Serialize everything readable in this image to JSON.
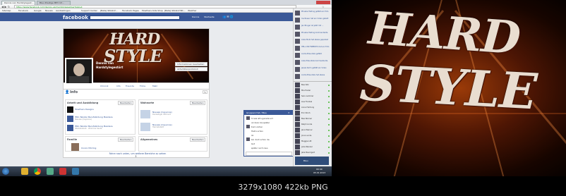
{
  "browser": {
    "active_tab": "Dennis van Hardstylegest…",
    "second_tab": "Bleu Prestige MP3 Inf…",
    "address": "https://www.facebook.com/dennis.vanhardstylegestoert/about",
    "bookmarks": [
      "Sitemap",
      "Facebook",
      "Google",
      "Nieuws",
      "Aanbiedingen",
      "Support Center",
      "[Beta] Stikstof…",
      "Facebook Pages",
      "Moethers Kids Shop",
      "[Beta] Stikstof Bit…",
      "Weather"
    ]
  },
  "facebook": {
    "logo": "facebook",
    "nav_links": [
      "Dennis",
      "Startseite"
    ],
    "profile_name_line1": "Dennis van",
    "profile_name_line2": "Hardstylegestört",
    "cover_buttons": [
      "Informationen bearbeiten",
      "Aktivitätenprotokoll"
    ],
    "profile_tabs": [
      "Chronik",
      "Info",
      "Freunde",
      "Fotos",
      "Mehr"
    ],
    "info_heading": "Info",
    "work_heading": "Arbeit und Ausbildung",
    "residence_heading": "Wohnorte",
    "family_heading": "Familie",
    "edit_label": "Bearbeiten",
    "work_items": [
      {
        "title": "Moethers Designs",
        "sub": ""
      },
      {
        "title": "HBA Tekstar Berufsbildung Meistere",
        "sub": "Nieuwe (Cayenne)"
      },
      {
        "title": "HBA Tekstar Berufsbildung Meistere",
        "sub": "Werkstudent · 2012 bis heute"
      }
    ],
    "residence_items": [
      {
        "title": "Nieuwe (Cayenne)",
        "sub": "Derzeitiger Wohnort"
      },
      {
        "title": "Nieuwe (Cayenne)",
        "sub": "Heimatstadt"
      }
    ],
    "family_items": [
      "Uxxxx Mörling"
    ],
    "details_heading": "Allgemeines",
    "scroll_hint": "Fahre nach unten, um weitere Bereiche zu sehen"
  },
  "chat": {
    "title": "Gruppenchat / Bleu",
    "messages": [
      "hi wie ist's gerade so?",
      "ok dann bis später",
      "Kurz vorbei",
      "Hab's schon",
      "lol",
      "bin doch schon da",
      "Gut",
      "später noch raus"
    ]
  },
  "sidebar": {
    "ticker": [
      "Phoebe Halting gefällt ein Foto",
      "Ina Rosen hat ein Video geteilt",
      "Jan Bruger ist jetzt mit …",
      "Phoebe Halting kommentierte",
      "Anke Mutz hat etwas gepostet",
      "HELL ON FIREBOYS hat ein Foto",
      "Andre Braunfels gefällt",
      "Anke Braunfels kommentierte",
      "Jessie Karm gefällt ein Video",
      "Andre Braunfels hat etwas"
    ],
    "contacts": [
      "Bea Sitz",
      "Mia Heder",
      "Sara Lemmer",
      "Lisa Frankel",
      "Anna Hartung",
      "Eric Stroh",
      "Bea Werner",
      "Ralph Linde",
      "Jana Werner",
      "Jona Lunde",
      "Maggie Litt",
      "Julia Wenzel",
      "Jalia Baumgart",
      "Tom Tom Der",
      "Daniel Hoste",
      "Eric Paulsen",
      "Kia Pencher",
      "Sebastian Bleis",
      "Anna Buchner"
    ],
    "chat_search": "Chat"
  },
  "taskbar": {
    "time": "00:40",
    "date": "05.01.2013",
    "popup_label": "Bleu"
  },
  "wallpaper": {
    "word1": "HARD",
    "word2": "STYLE"
  },
  "cover_art": {
    "word1": "HARD",
    "word2": "STYLE"
  },
  "caption": "3279x1080  422kb  PNG"
}
